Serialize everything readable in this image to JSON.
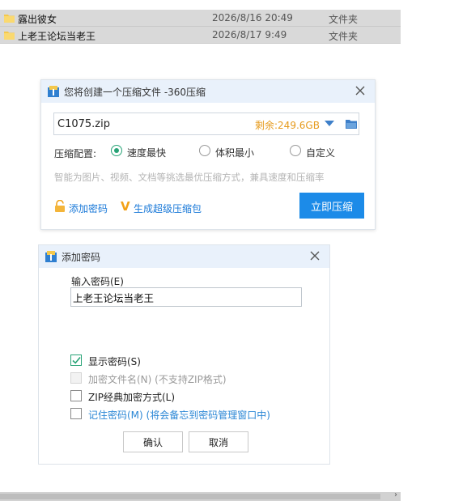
{
  "files": [
    {
      "name": "露出彼女",
      "date": "2026/8/16 20:49",
      "type": "文件夹"
    },
    {
      "name": "上老王论坛当老王",
      "date": "2026/8/17 9:49",
      "type": "文件夹"
    }
  ],
  "compress_dialog": {
    "title": "您将创建一个压缩文件 -360压缩",
    "filename": "C1075.zip",
    "space": "剩余:249.6GB",
    "options_label": "压缩配置:",
    "options": [
      "速度最快",
      "体积最小",
      "自定义"
    ],
    "selected_option": "速度最快",
    "hint": "智能为图片、视频、文档等挑选最优压缩方式，兼具速度和压缩率",
    "add_password": "添加密码",
    "super_pack": "生成超级压缩包",
    "compress_now": "立即压缩"
  },
  "password_dialog": {
    "title": "添加密码",
    "field_label": "输入密码(E)",
    "password_value": "上老王论坛当老王",
    "checkboxes": [
      {
        "label": "显示密码(S)",
        "checked": true,
        "disabled": false
      },
      {
        "label": "加密文件名(N) (不支持ZIP格式)",
        "checked": false,
        "disabled": true
      },
      {
        "label": "ZIP经典加密方式(L)",
        "checked": false,
        "disabled": false
      },
      {
        "label": "记住密码(M) (将会备忘到密码管理窗口中)",
        "checked": false,
        "disabled": false
      }
    ],
    "ok": "确认",
    "cancel": "取消"
  },
  "colors": {
    "accent": "#1c8be8",
    "success": "#27a376",
    "warning": "#e69a1b",
    "titlebar": "#e9f1fb"
  }
}
